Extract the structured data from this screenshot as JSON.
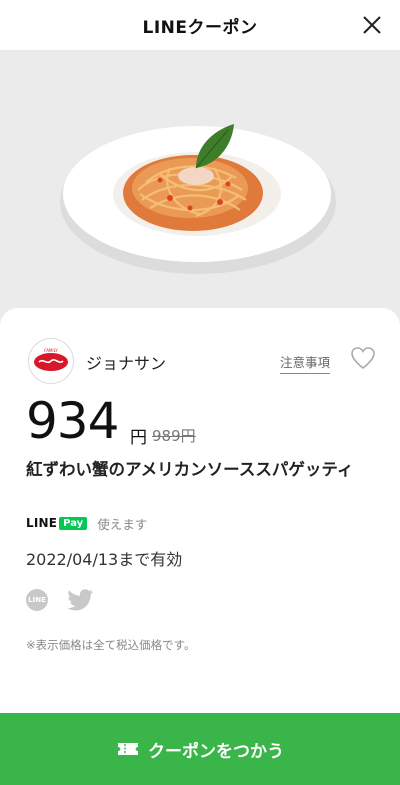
{
  "header": {
    "title": "LINEクーポン"
  },
  "brand": {
    "name": "ジョナサン",
    "logo_text": "ジョナサン"
  },
  "notice": {
    "label": "注意事項"
  },
  "price": {
    "current": "934",
    "unit": "円",
    "original": "989円"
  },
  "product": {
    "name": "紅ずわい蟹のアメリカンソーススパゲッティ"
  },
  "payment": {
    "line_logo": "LINE",
    "pay_label": "Pay",
    "usable_text": "使えます"
  },
  "expiry": {
    "text": "2022/04/13まで有効"
  },
  "share": {
    "line_label": "LINE"
  },
  "note": {
    "text": "※表示価格は全て税込価格です。"
  },
  "cta": {
    "label": "クーポンをつかう"
  },
  "colors": {
    "accent_green": "#3ab54a",
    "line_green": "#06c755",
    "brand_red": "#d7182a"
  }
}
